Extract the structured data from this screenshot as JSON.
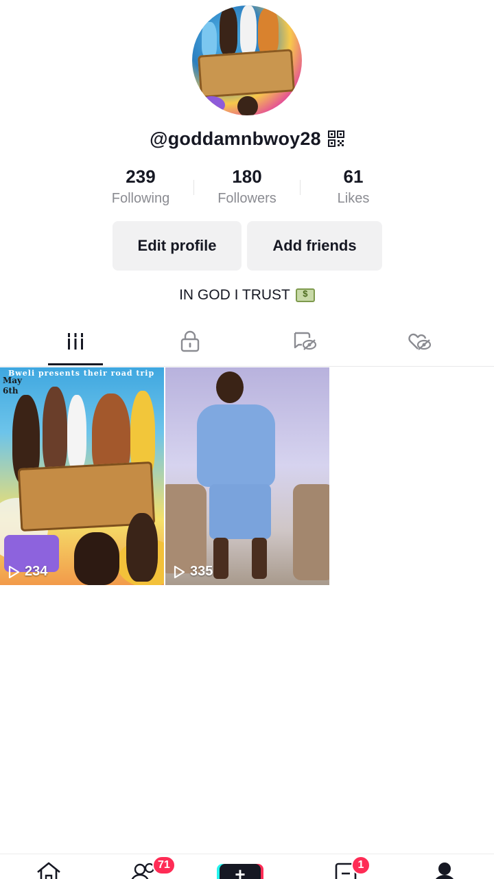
{
  "profile": {
    "username": "@goddamnbwoy28",
    "bio": "IN GOD I TRUST",
    "bio_emoji": "money-bill-icon"
  },
  "stats": [
    {
      "value": "239",
      "label": "Following"
    },
    {
      "value": "180",
      "label": "Followers"
    },
    {
      "value": "61",
      "label": "Likes"
    }
  ],
  "buttons": {
    "edit_profile": "Edit profile",
    "add_friends": "Add friends"
  },
  "tabs": [
    {
      "name": "videos",
      "icon": "grid-icon",
      "active": true
    },
    {
      "name": "private",
      "icon": "lock-icon",
      "active": false
    },
    {
      "name": "reposts",
      "icon": "hidden-repost-icon",
      "active": false
    },
    {
      "name": "liked",
      "icon": "hidden-heart-icon",
      "active": false
    }
  ],
  "videos": [
    {
      "views": "234",
      "poster_title": "Bweli presents their road trip",
      "poster_date": "May\n6th"
    },
    {
      "views": "335"
    }
  ],
  "bottom_nav": {
    "friends_badge": "71",
    "inbox_badge": "1"
  },
  "colors": {
    "accent": "#fe2c55",
    "accent_cyan": "#25f4ee",
    "text_primary": "#161823",
    "text_secondary": "#8a8b91",
    "button_bg": "#f1f1f2"
  }
}
